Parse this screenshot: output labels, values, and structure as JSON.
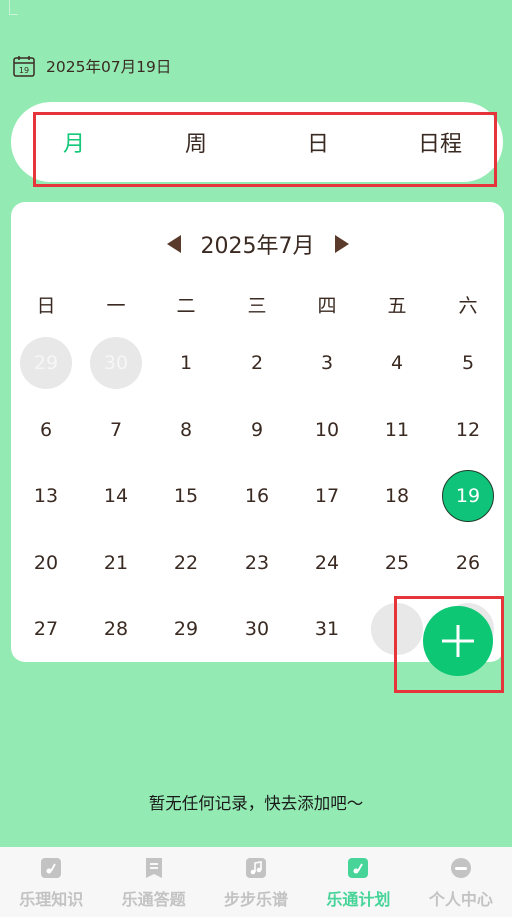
{
  "header": {
    "date": "2025年07月19日",
    "calendar_icon_day": "19"
  },
  "tabs": [
    {
      "label": "月",
      "active": true
    },
    {
      "label": "周",
      "active": false
    },
    {
      "label": "日",
      "active": false
    },
    {
      "label": "日程",
      "active": false
    }
  ],
  "calendar": {
    "month_title": "2025年7月",
    "weekdays": [
      "日",
      "一",
      "二",
      "三",
      "四",
      "五",
      "六"
    ],
    "weeks": [
      [
        {
          "d": "29",
          "t": "other"
        },
        {
          "d": "30",
          "t": "other"
        },
        {
          "d": "1",
          "t": "cur"
        },
        {
          "d": "2",
          "t": "cur"
        },
        {
          "d": "3",
          "t": "cur"
        },
        {
          "d": "4",
          "t": "cur"
        },
        {
          "d": "5",
          "t": "cur"
        }
      ],
      [
        {
          "d": "6",
          "t": "cur"
        },
        {
          "d": "7",
          "t": "cur"
        },
        {
          "d": "8",
          "t": "cur"
        },
        {
          "d": "9",
          "t": "cur"
        },
        {
          "d": "10",
          "t": "cur"
        },
        {
          "d": "11",
          "t": "cur"
        },
        {
          "d": "12",
          "t": "cur"
        }
      ],
      [
        {
          "d": "13",
          "t": "cur"
        },
        {
          "d": "14",
          "t": "cur"
        },
        {
          "d": "15",
          "t": "cur"
        },
        {
          "d": "16",
          "t": "cur"
        },
        {
          "d": "17",
          "t": "cur"
        },
        {
          "d": "18",
          "t": "cur"
        },
        {
          "d": "19",
          "t": "today"
        }
      ],
      [
        {
          "d": "20",
          "t": "cur"
        },
        {
          "d": "21",
          "t": "cur"
        },
        {
          "d": "22",
          "t": "cur"
        },
        {
          "d": "23",
          "t": "cur"
        },
        {
          "d": "24",
          "t": "cur"
        },
        {
          "d": "25",
          "t": "cur"
        },
        {
          "d": "26",
          "t": "cur"
        }
      ],
      [
        {
          "d": "27",
          "t": "cur"
        },
        {
          "d": "28",
          "t": "cur"
        },
        {
          "d": "29",
          "t": "cur"
        },
        {
          "d": "30",
          "t": "cur"
        },
        {
          "d": "31",
          "t": "cur"
        },
        {
          "d": "",
          "t": "blank"
        },
        {
          "d": "",
          "t": "blank"
        }
      ]
    ],
    "prev_icon": "triangle-left-icon",
    "next_icon": "triangle-right-icon"
  },
  "empty_message": "暂无任何记录，快去添加吧～",
  "fab_icon": "plus-icon",
  "bottom_nav": [
    {
      "label": "乐理知识",
      "icon": "note-icon",
      "active": false
    },
    {
      "label": "乐通答题",
      "icon": "document-icon",
      "active": false
    },
    {
      "label": "步步乐谱",
      "icon": "music-icon",
      "active": false
    },
    {
      "label": "乐通计划",
      "icon": "note-icon",
      "active": true
    },
    {
      "label": "个人中心",
      "icon": "person-icon",
      "active": false
    }
  ],
  "colors": {
    "background": "#93ebb3",
    "accent": "#10c37a",
    "highlight_box": "#e6353a",
    "nav_active": "#47d499",
    "nav_inactive": "#c3c3c3"
  }
}
